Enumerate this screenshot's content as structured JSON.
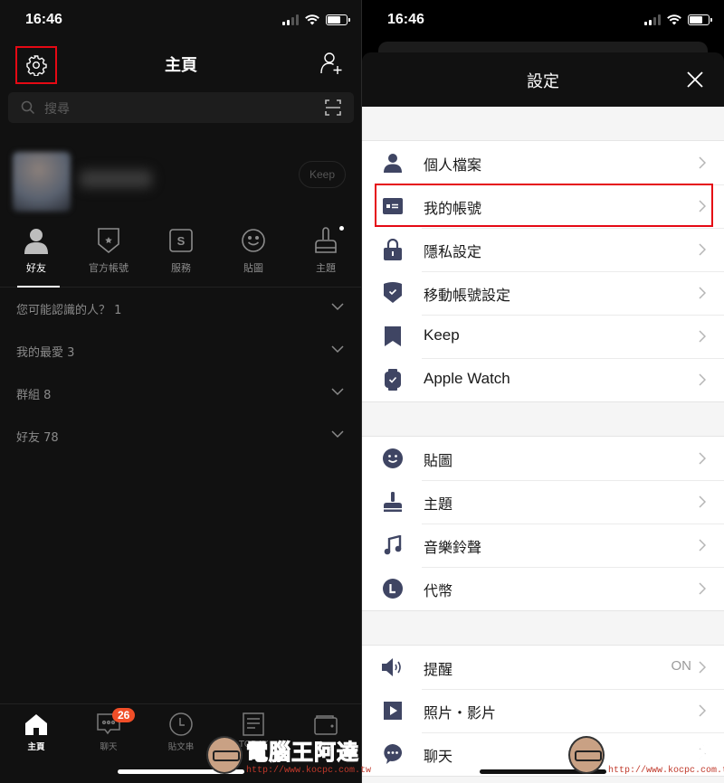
{
  "status_bar": {
    "time": "16:46"
  },
  "left": {
    "header": {
      "title": "主頁"
    },
    "search": {
      "placeholder": "搜尋"
    },
    "profile": {
      "keep_label": "Keep"
    },
    "tabs": [
      {
        "label": "好友",
        "icon": "person-icon",
        "active": true
      },
      {
        "label": "官方帳號",
        "icon": "shield-star-icon"
      },
      {
        "label": "服務",
        "icon": "service-s-icon"
      },
      {
        "label": "貼圖",
        "icon": "smiley-icon"
      },
      {
        "label": "主題",
        "icon": "brush-icon",
        "has_dot": true
      }
    ],
    "groups": [
      {
        "label": "您可能認識的人？ 1"
      },
      {
        "label": "我的最愛 3"
      },
      {
        "label": "群組 8"
      },
      {
        "label": "好友 78"
      }
    ],
    "bottom_nav": [
      {
        "label": "主頁",
        "icon": "home-icon",
        "active": true
      },
      {
        "label": "聊天",
        "icon": "chat-icon",
        "badge": "26"
      },
      {
        "label": "貼文串",
        "icon": "clock-icon"
      },
      {
        "label": "TODAY",
        "icon": "news-icon"
      },
      {
        "label": "錢包",
        "icon": "wallet-icon"
      }
    ]
  },
  "right": {
    "header": {
      "title": "設定"
    },
    "sections": [
      [
        {
          "label": "個人檔案",
          "icon": "person-icon"
        },
        {
          "label": "我的帳號",
          "icon": "id-card-icon",
          "highlighted": true
        },
        {
          "label": "隱私設定",
          "icon": "lock-icon"
        },
        {
          "label": "移動帳號設定",
          "icon": "shield-check-icon"
        },
        {
          "label": "Keep",
          "icon": "bookmark-icon"
        },
        {
          "label": "Apple Watch",
          "icon": "watch-icon"
        }
      ],
      [
        {
          "label": "貼圖",
          "icon": "smiley-icon"
        },
        {
          "label": "主題",
          "icon": "brush-icon"
        },
        {
          "label": "音樂鈴聲",
          "icon": "music-note-icon"
        },
        {
          "label": "代幣",
          "icon": "coin-icon"
        }
      ],
      [
        {
          "label": "提醒",
          "icon": "speaker-icon",
          "value": "ON"
        },
        {
          "label": "照片・影片",
          "icon": "play-icon"
        },
        {
          "label": "聊天",
          "icon": "chat-bubble-icon"
        }
      ]
    ]
  },
  "watermark": {
    "title": "電腦王阿達",
    "url": "http://www.kocpc.com.tw"
  },
  "colors": {
    "highlight": "#e50914",
    "icon": "#3f4563",
    "badge": "#f04e28"
  }
}
